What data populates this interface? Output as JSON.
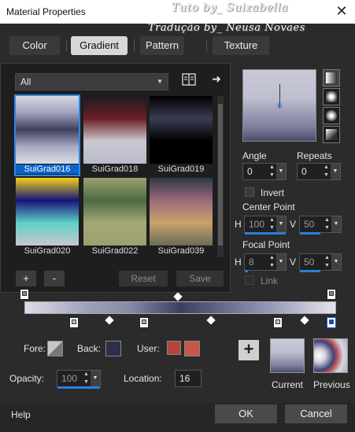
{
  "window": {
    "title": "Material Properties",
    "watermark_line1": "Tuto by_ Suizabella",
    "watermark_line2": "Tradução by_ Neusa Novaes",
    "close_glyph": "✕"
  },
  "tabs": [
    {
      "label": "Color",
      "active": false
    },
    {
      "label": "Gradient",
      "active": true
    },
    {
      "label": "Pattern",
      "active": false
    },
    {
      "label": "Texture",
      "active": false
    }
  ],
  "library": {
    "category": "All",
    "dropdown_arrow": "▼",
    "book_icon": "book-icon",
    "arrow_glyph": "➜",
    "gradients": [
      {
        "label": "SuiGrad016",
        "selected": true,
        "colors": [
          "#d8d8e6",
          "#9fa1bb",
          "#3d3f60",
          "#a8aac2",
          "#dcdce8"
        ]
      },
      {
        "label": "SuiGrad018",
        "selected": false,
        "colors": [
          "#1c1c22",
          "#6a1e22",
          "#ccc8d0",
          "#b9bbcc"
        ]
      },
      {
        "label": "SuiGrad019",
        "selected": false,
        "colors": [
          "#000000",
          "#3a3c52",
          "#000000",
          "#000000"
        ]
      },
      {
        "label": "SuiGrad020",
        "selected": false,
        "colors": [
          "#f2d21a",
          "#16147a",
          "#5ed0c8",
          "#c8c8cc"
        ]
      },
      {
        "label": "SuiGrad022",
        "selected": false,
        "colors": [
          "#9aa070",
          "#4c6a44",
          "#a4a878",
          "#9ca070"
        ]
      },
      {
        "label": "SuiGrad039",
        "selected": false,
        "colors": [
          "#2e3846",
          "#9c6a7a",
          "#c9a26a",
          "#6a6a5a"
        ]
      }
    ],
    "add_label": "+",
    "remove_label": "-",
    "reset_label": "Reset",
    "save_label": "Save"
  },
  "style_buttons": [
    "linear-style-icon",
    "rectangular-style-icon",
    "sunburst-style-icon",
    "radial-style-icon"
  ],
  "angle": {
    "label": "Angle",
    "value": "0"
  },
  "repeats": {
    "label": "Repeats",
    "value": "0"
  },
  "invert": {
    "label": "Invert",
    "checked": false
  },
  "center_point": {
    "label": "Center Point",
    "h_label": "H",
    "h_value": "100",
    "h_percent": 100,
    "v_label": "V",
    "v_value": "50",
    "v_percent": 50
  },
  "focal_point": {
    "label": "Focal Point",
    "h_label": "H",
    "h_value": "8",
    "h_percent": 8,
    "v_label": "V",
    "v_value": "50",
    "v_percent": 50
  },
  "link": {
    "label": "Link",
    "checked": false
  },
  "gradient_editor": {
    "colors": [
      "#dcdce8",
      "#9fa1bb",
      "#8a8ca9",
      "#3d3f60",
      "#9a9cb8",
      "#d3d3e0",
      "#e4e4ee"
    ],
    "stops_location_percent": [
      0,
      100,
      16,
      45,
      82,
      100
    ],
    "midpoints_percent": [
      50,
      28,
      61,
      90
    ]
  },
  "fore": {
    "label": "Fore:"
  },
  "back": {
    "label": "Back:",
    "color": "#2c2f48"
  },
  "user": {
    "label": "User:",
    "color1": "#b5443c",
    "color2": "#c8564a"
  },
  "opacity": {
    "label": "Opacity:",
    "value": "100",
    "percent": 100
  },
  "location": {
    "label": "Location:",
    "value": "16"
  },
  "current": {
    "label": "Current"
  },
  "previous": {
    "label": "Previous"
  },
  "add_swatch": "+",
  "footer": {
    "help": "Help",
    "ok": "OK",
    "cancel": "Cancel"
  },
  "spin_arrows": {
    "up": "▲",
    "down": "▼"
  }
}
